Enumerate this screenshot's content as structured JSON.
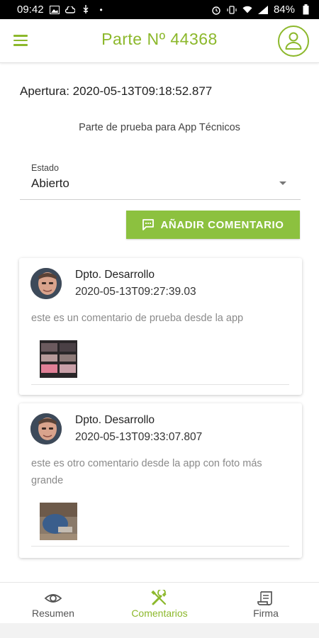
{
  "status_bar": {
    "time": "09:42",
    "battery": "84%"
  },
  "header": {
    "title": "Parte Nº 44368"
  },
  "parte": {
    "apertura": "Apertura: 2020-05-13T09:18:52.877",
    "descripcion": "Parte de prueba para App Técnicos",
    "estado_label": "Estado",
    "estado_value": "Abierto"
  },
  "add_comment_button": {
    "label": "AÑADIR COMENTARIO"
  },
  "comments": [
    {
      "author": "Dpto. Desarrollo",
      "date": "2020-05-13T09:27:39.03",
      "text": "este es un comentario de prueba desde la app"
    },
    {
      "author": "Dpto. Desarrollo",
      "date": "2020-05-13T09:33:07.807",
      "text": "este es otro comentario desde la app con foto más grande"
    }
  ],
  "bottom_nav": {
    "items": [
      {
        "label": "Resumen",
        "icon": "eye-icon"
      },
      {
        "label": "Comentarios",
        "icon": "tools-icon"
      },
      {
        "label": "Firma",
        "icon": "document-icon"
      }
    ],
    "active_index": 1
  },
  "colors": {
    "accent": "#8cb82b",
    "button": "#8cc13f",
    "status_bar": "#000000"
  }
}
